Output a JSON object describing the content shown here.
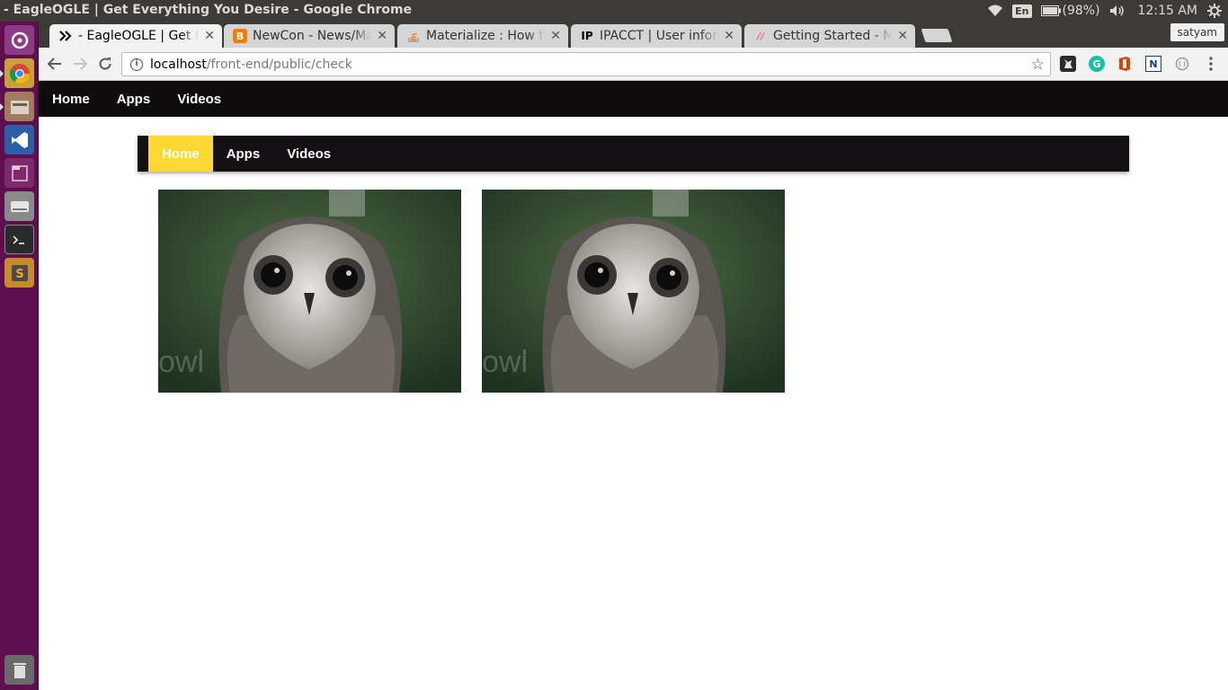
{
  "system": {
    "window_title": "- EagleOGLE | Get Everything You Desire - Google Chrome",
    "lang": "En",
    "battery": "(98%)",
    "clock": "12:15 AM"
  },
  "browser": {
    "profile": "satyam",
    "tabs": [
      {
        "label": "- EagleOGLE | Get Everything You Desire",
        "active": true
      },
      {
        "label": "NewCon - News/Magazine"
      },
      {
        "label": "Materialize : How to"
      },
      {
        "label": "IPACCT | User information"
      },
      {
        "label": "Getting Started - Materialize"
      }
    ],
    "url_host": "localhost",
    "url_path": "/front-end/public/check"
  },
  "site_nav": {
    "items": [
      "Home",
      "Apps",
      "Videos"
    ]
  },
  "inner_nav": {
    "items": [
      "Home",
      "Apps",
      "Videos"
    ],
    "active": "Home"
  },
  "cards": [
    {
      "caption": "owl"
    },
    {
      "caption": "owl"
    }
  ],
  "colors": {
    "launcher": "#5e0f4e",
    "nav_bg": "#0f0c0e",
    "active_accent": "#fdd835"
  }
}
